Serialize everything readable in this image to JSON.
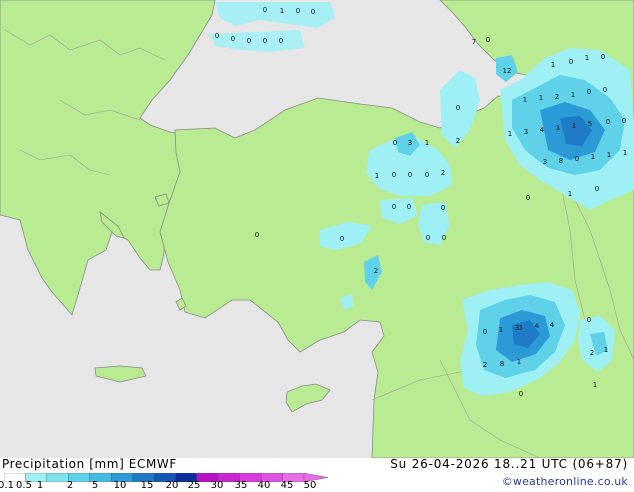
{
  "map": {
    "labels": [
      {
        "id": "g1",
        "text": "0"
      },
      {
        "id": "g2",
        "text": "1"
      },
      {
        "id": "g3",
        "text": "0"
      },
      {
        "id": "g4",
        "text": "0"
      },
      {
        "id": "g5",
        "text": "0"
      },
      {
        "id": "g6",
        "text": "0"
      },
      {
        "id": "g7",
        "text": "0"
      },
      {
        "id": "g8",
        "text": "0"
      },
      {
        "id": "g9",
        "text": "0"
      },
      {
        "id": "k1",
        "text": "7"
      },
      {
        "id": "k2",
        "text": "0"
      },
      {
        "id": "k3",
        "text": "12"
      },
      {
        "id": "k4",
        "text": "1"
      },
      {
        "id": "k5",
        "text": "0"
      },
      {
        "id": "k6",
        "text": "1"
      },
      {
        "id": "k7",
        "text": "0"
      },
      {
        "id": "k8",
        "text": "1"
      },
      {
        "id": "k9",
        "text": "1"
      },
      {
        "id": "k10",
        "text": "2"
      },
      {
        "id": "k11",
        "text": "1"
      },
      {
        "id": "k12",
        "text": "0"
      },
      {
        "id": "k13",
        "text": "0"
      },
      {
        "id": "k14",
        "text": "1"
      },
      {
        "id": "k15",
        "text": "3"
      },
      {
        "id": "k16",
        "text": "4"
      },
      {
        "id": "k17",
        "text": "1"
      },
      {
        "id": "k18",
        "text": "1"
      },
      {
        "id": "k19",
        "text": "5"
      },
      {
        "id": "k20",
        "text": "0"
      },
      {
        "id": "k21",
        "text": "0"
      },
      {
        "id": "k22",
        "text": "3"
      },
      {
        "id": "k23",
        "text": "8"
      },
      {
        "id": "k24",
        "text": "0"
      },
      {
        "id": "k25",
        "text": "1"
      },
      {
        "id": "k26",
        "text": "1"
      },
      {
        "id": "k27",
        "text": "1"
      },
      {
        "id": "k28",
        "text": "0"
      },
      {
        "id": "k29",
        "text": "0"
      },
      {
        "id": "k30",
        "text": "1"
      },
      {
        "id": "t1",
        "text": "0"
      },
      {
        "id": "t2",
        "text": "2"
      },
      {
        "id": "t3",
        "text": "3"
      },
      {
        "id": "t4",
        "text": "1"
      },
      {
        "id": "t5",
        "text": "0"
      },
      {
        "id": "t6",
        "text": "1"
      },
      {
        "id": "t7",
        "text": "0"
      },
      {
        "id": "t8",
        "text": "0"
      },
      {
        "id": "t9",
        "text": "0"
      },
      {
        "id": "t10",
        "text": "2"
      },
      {
        "id": "t11",
        "text": "0"
      },
      {
        "id": "t12",
        "text": "0"
      },
      {
        "id": "t13",
        "text": "0"
      },
      {
        "id": "t14",
        "text": "0"
      },
      {
        "id": "t15",
        "text": "0"
      },
      {
        "id": "t16",
        "text": "0"
      },
      {
        "id": "t17",
        "text": "0"
      },
      {
        "id": "t18",
        "text": "2"
      },
      {
        "id": "s1",
        "text": "0"
      },
      {
        "id": "s2",
        "text": "1"
      },
      {
        "id": "s3",
        "text": "3"
      },
      {
        "id": "s4",
        "text": "4"
      },
      {
        "id": "s5",
        "text": "4"
      },
      {
        "id": "s6",
        "text": "0"
      },
      {
        "id": "s7",
        "text": "1"
      },
      {
        "id": "s8",
        "text": "2"
      },
      {
        "id": "s9",
        "text": "8"
      },
      {
        "id": "s10",
        "text": "1"
      },
      {
        "id": "s11",
        "text": "0"
      },
      {
        "id": "s12",
        "text": "2"
      },
      {
        "id": "s13",
        "text": "1"
      },
      {
        "id": "s14",
        "text": "1"
      },
      {
        "id": "s15",
        "text": "1"
      }
    ]
  },
  "footer": {
    "left_text": "Precipitation [mm] ECMWF",
    "right_text": "Su 26-04-2026 18..21 UTC (06+87)",
    "credit": "©weatheronline.co.uk"
  },
  "legend": {
    "ticks": [
      "0.1",
      "0.5",
      "1",
      "2",
      "5",
      "10",
      "15",
      "20",
      "25",
      "30",
      "35",
      "40",
      "45",
      "50"
    ],
    "colors": [
      "#ffffff",
      "#9ff0f5",
      "#7fe3f0",
      "#5fd2ea",
      "#40bde3",
      "#2a9bd7",
      "#1f7ac8",
      "#1557b5",
      "#0d2f9e",
      "#b90fc7",
      "#cc26d3",
      "#d83adb",
      "#e052e1",
      "#e96de7"
    ]
  }
}
